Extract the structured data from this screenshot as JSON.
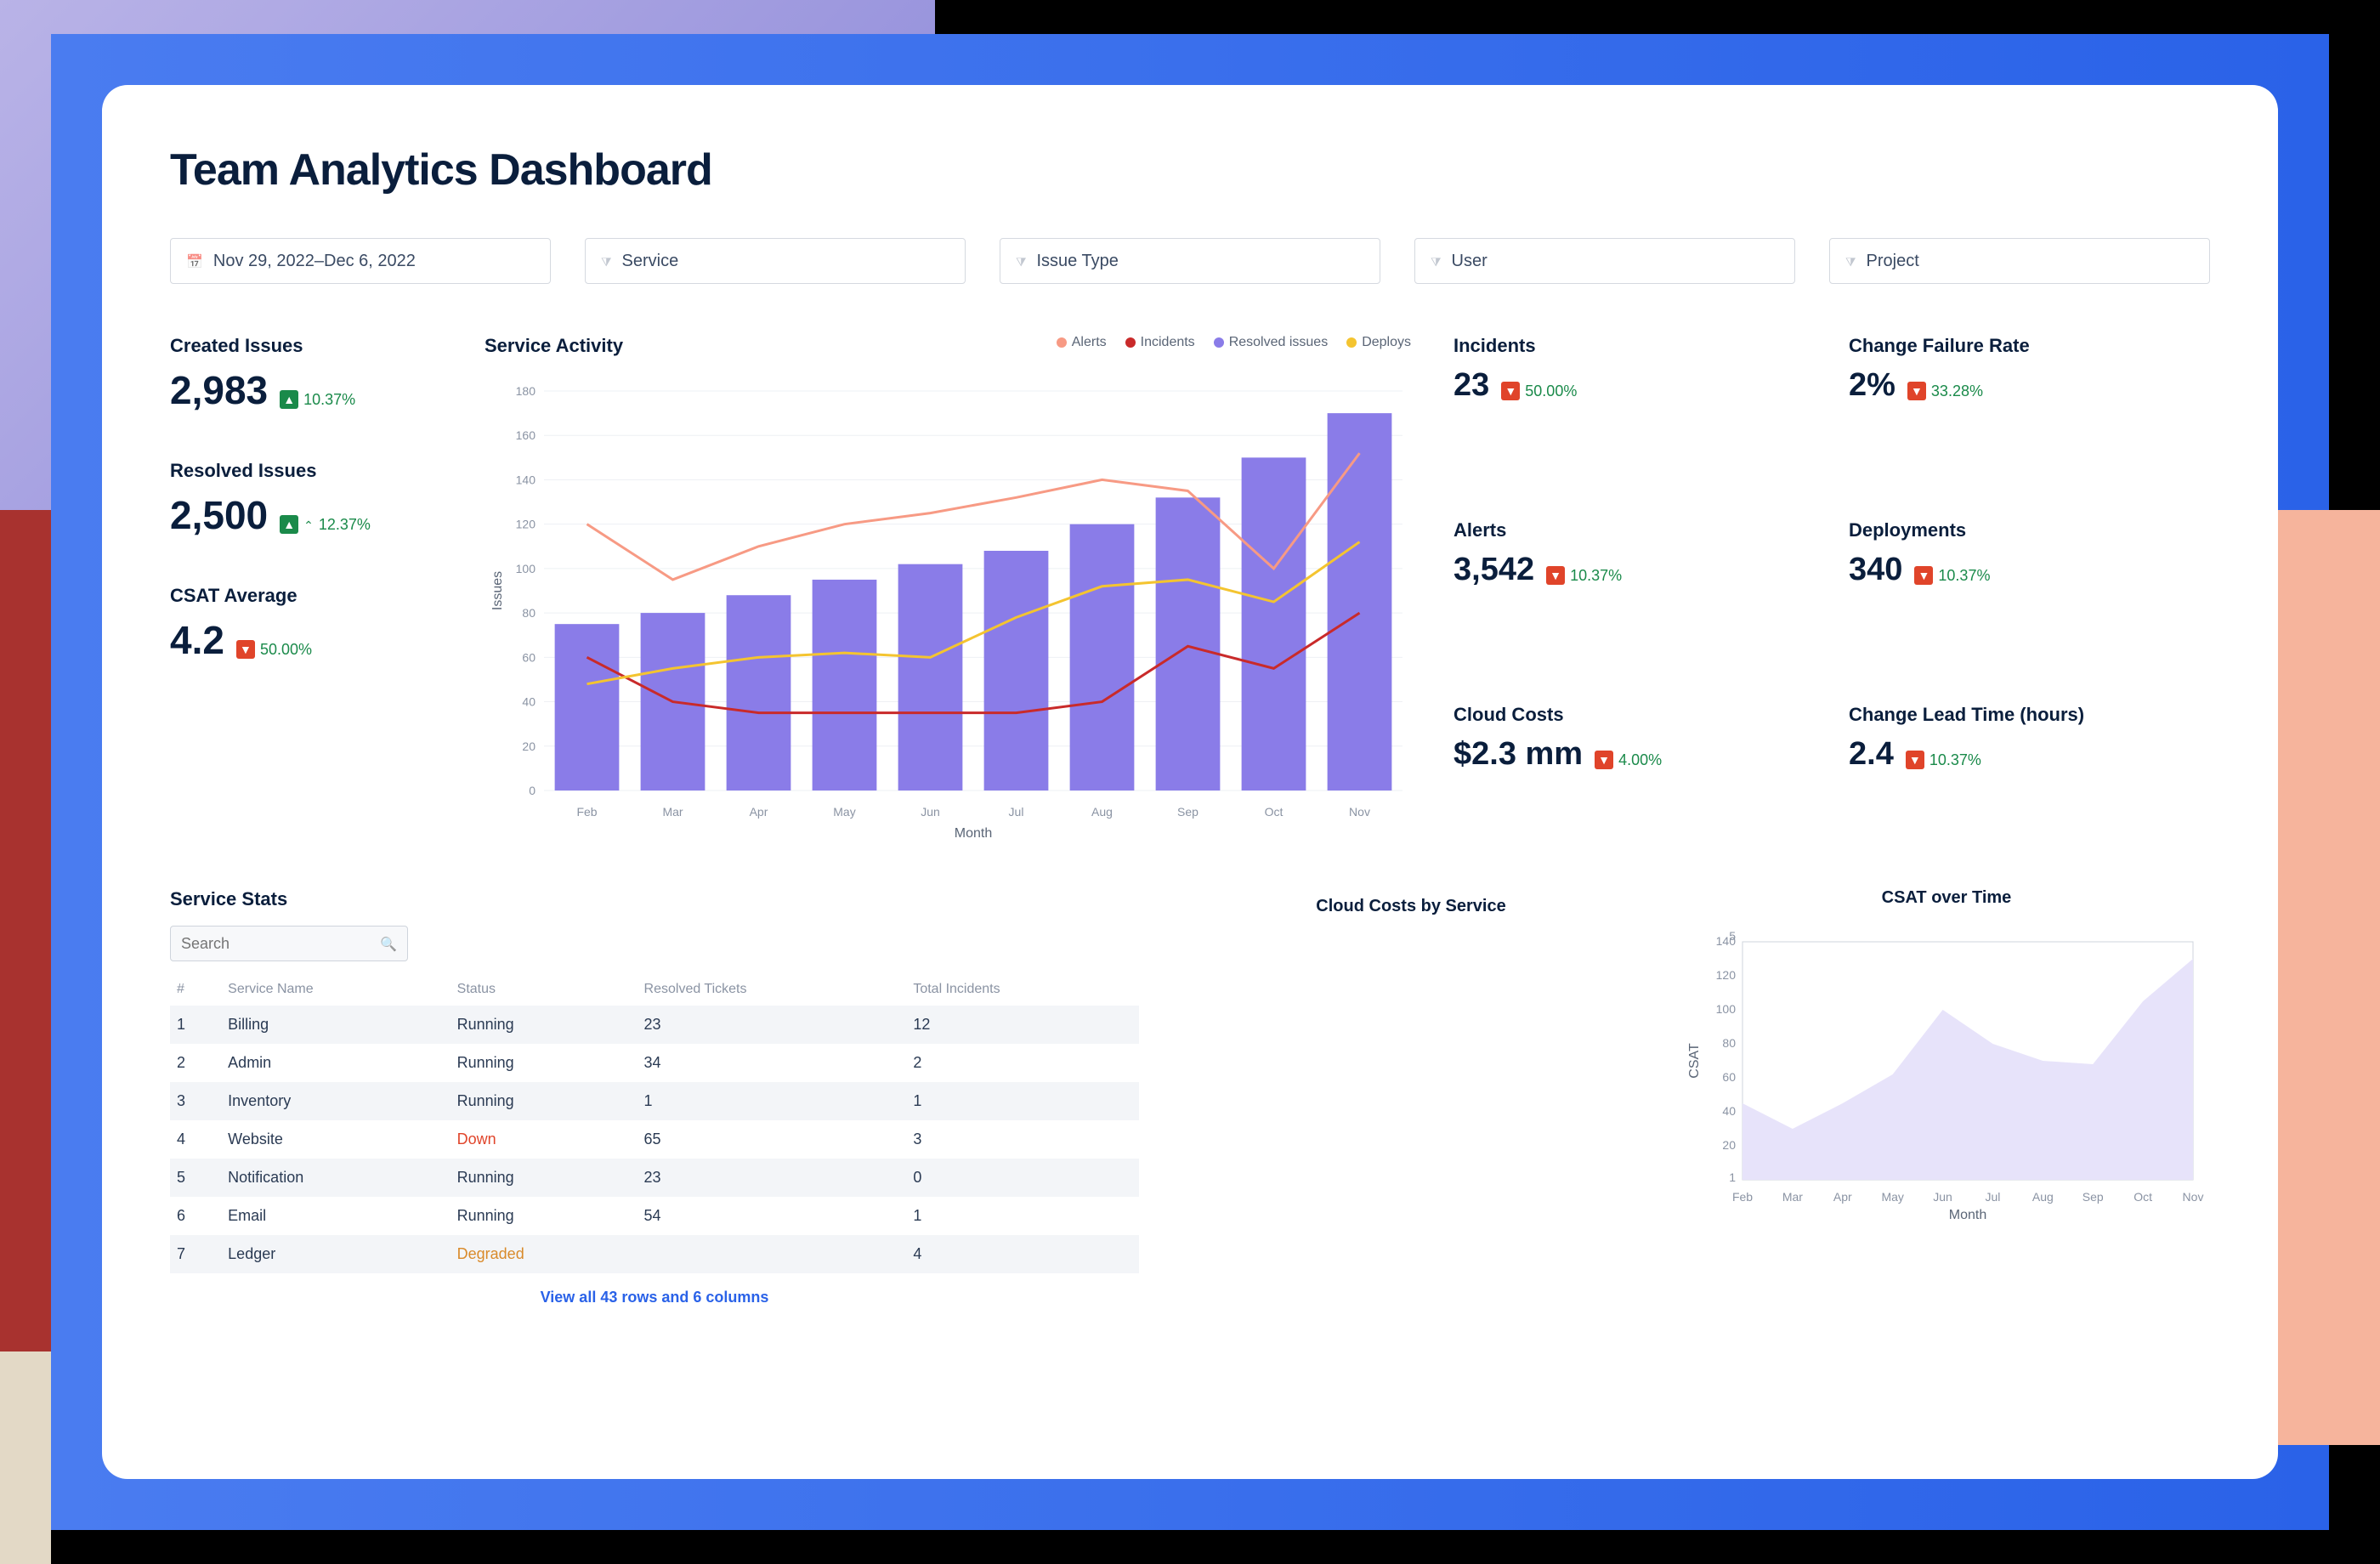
{
  "title": "Team Analytics Dashboard",
  "filters": {
    "date_range": "Nov 29, 2022–Dec 6, 2022",
    "service": "Service",
    "issue_type": "Issue Type",
    "user": "User",
    "project": "Project"
  },
  "kpis_left": {
    "created_issues": {
      "label": "Created Issues",
      "value": "2,983",
      "delta": "10.37%",
      "dir": "up",
      "badge": "green"
    },
    "resolved_issues": {
      "label": "Resolved Issues",
      "value": "2,500",
      "delta": "12.37%",
      "dir": "up",
      "badge": "green",
      "caret": true
    },
    "csat_avg": {
      "label": "CSAT Average",
      "value": "4.2",
      "delta": "50.00%",
      "dir": "down",
      "badge": "red"
    }
  },
  "kpis_right": {
    "incidents": {
      "label": "Incidents",
      "value": "23",
      "delta": "50.00%",
      "badge": "red"
    },
    "cfr": {
      "label": "Change Failure Rate",
      "value": "2%",
      "delta": "33.28%",
      "badge": "red"
    },
    "alerts": {
      "label": "Alerts",
      "value": "3,542",
      "delta": "10.37%",
      "badge": "red"
    },
    "deployments": {
      "label": "Deployments",
      "value": "340",
      "delta": "10.37%",
      "badge": "red"
    },
    "cloud_costs": {
      "label": "Cloud Costs",
      "value": "$2.3 mm",
      "delta": "4.00%",
      "badge": "red"
    },
    "change_lead_time": {
      "label": "Change Lead Time (hours)",
      "value": "2.4",
      "delta": "10.37%",
      "badge": "red"
    }
  },
  "service_activity": {
    "title": "Service Activity",
    "legend": {
      "alerts": "Alerts",
      "incidents": "Incidents",
      "resolved": "Resolved issues",
      "deploys": "Deploys"
    },
    "colors": {
      "alerts": "#f79a84",
      "incidents": "#c92a2a",
      "resolved": "#8a7ce8",
      "deploys": "#f4c430"
    },
    "xlabel": "Month",
    "ylabel": "Issues"
  },
  "service_stats": {
    "title": "Service Stats",
    "search_placeholder": "Search",
    "columns": [
      "#",
      "Service Name",
      "Status",
      "Resolved Tickets",
      "Total Incidents"
    ],
    "view_all": "View all 43 rows and 6 columns"
  },
  "cloud_costs_panel": {
    "title": "Cloud Costs by Service"
  },
  "csat_panel": {
    "title": "CSAT over Time",
    "ylabel": "CSAT",
    "xlabel": "Month"
  },
  "chart_data": [
    {
      "id": "service_activity",
      "type": "bar+line",
      "title": "Service Activity",
      "xlabel": "Month",
      "ylabel": "Issues",
      "ylim": [
        0,
        180
      ],
      "yticks": [
        0,
        20,
        40,
        60,
        80,
        100,
        120,
        140,
        160,
        180
      ],
      "categories": [
        "Feb",
        "Mar",
        "Apr",
        "May",
        "Jun",
        "Jul",
        "Aug",
        "Sep",
        "Oct",
        "Nov"
      ],
      "series": [
        {
          "name": "Resolved issues",
          "role": "bar",
          "color": "#8a7ce8",
          "values": [
            75,
            80,
            88,
            95,
            102,
            108,
            120,
            132,
            150,
            170
          ]
        },
        {
          "name": "Alerts",
          "role": "line",
          "color": "#f79a84",
          "values": [
            120,
            95,
            110,
            120,
            125,
            132,
            140,
            135,
            100,
            152
          ]
        },
        {
          "name": "Incidents",
          "role": "line",
          "color": "#c92a2a",
          "values": [
            60,
            40,
            35,
            35,
            35,
            35,
            40,
            65,
            55,
            80
          ]
        },
        {
          "name": "Deploys",
          "role": "line",
          "color": "#f4c430",
          "values": [
            48,
            55,
            60,
            62,
            60,
            78,
            92,
            95,
            85,
            112
          ]
        }
      ]
    },
    {
      "id": "csat_over_time",
      "type": "area",
      "title": "CSAT over Time",
      "xlabel": "Month",
      "ylabel": "CSAT",
      "ylim": [
        0,
        140
      ],
      "yticks": [
        1,
        20,
        40,
        60,
        80,
        100,
        120,
        140
      ],
      "top_tick": "5",
      "categories": [
        "Feb",
        "Mar",
        "Apr",
        "May",
        "Jun",
        "Jul",
        "Aug",
        "Sep",
        "Oct",
        "Nov"
      ],
      "series": [
        {
          "name": "CSAT",
          "color": "#8a7ce8",
          "fill": "#e7e3fa",
          "values": [
            45,
            30,
            45,
            62,
            100,
            80,
            70,
            68,
            105,
            130
          ]
        }
      ]
    },
    {
      "id": "service_stats_table",
      "type": "table",
      "title": "Service Stats",
      "columns": [
        "#",
        "Service Name",
        "Status",
        "Resolved Tickets",
        "Total Incidents"
      ],
      "rows": [
        [
          "1",
          "Billing",
          "Running",
          "23",
          "12"
        ],
        [
          "2",
          "Admin",
          "Running",
          "34",
          "2"
        ],
        [
          "3",
          "Inventory",
          "Running",
          "1",
          "1"
        ],
        [
          "4",
          "Website",
          "Down",
          "65",
          "3"
        ],
        [
          "5",
          "Notification",
          "Running",
          "23",
          "0"
        ],
        [
          "6",
          "Email",
          "Running",
          "54",
          "1"
        ],
        [
          "7",
          "Ledger",
          "Degraded",
          "",
          "4"
        ]
      ]
    }
  ]
}
